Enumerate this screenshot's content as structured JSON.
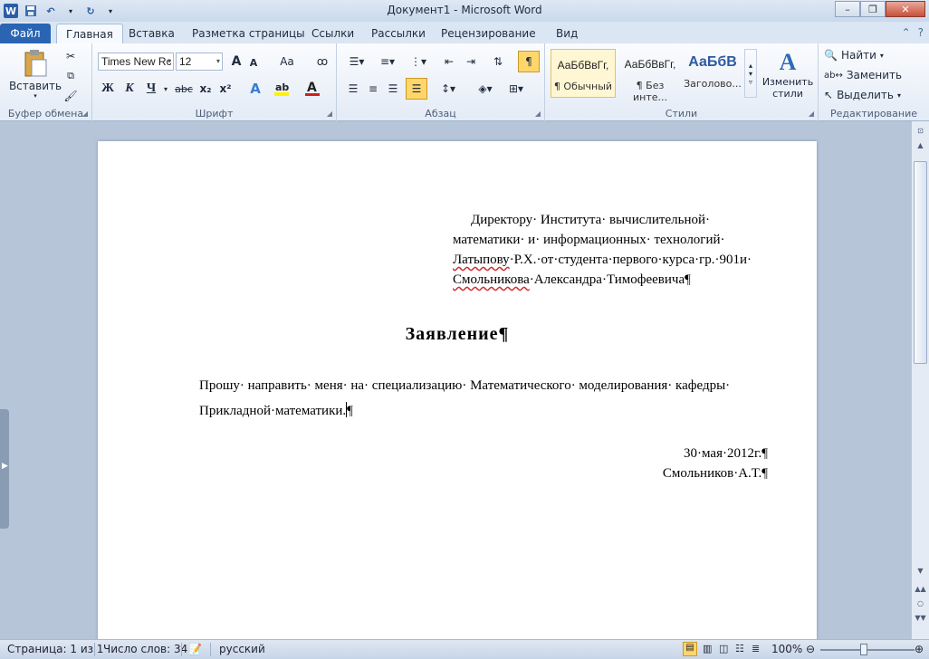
{
  "window": {
    "title": "Документ1 - Microsoft Word"
  },
  "tabs": {
    "file": "Файл",
    "home": "Главная",
    "insert": "Вставка",
    "layout": "Разметка страницы",
    "references": "Ссылки",
    "mailings": "Рассылки",
    "review": "Рецензирование",
    "view": "Вид"
  },
  "ribbon": {
    "clipboard": {
      "label": "Буфер обмена",
      "paste": "Вставить"
    },
    "font": {
      "label": "Шрифт",
      "name": "Times New Rc",
      "size": "12",
      "grow": "A",
      "shrink": "A",
      "case": "Aa",
      "bold": "Ж",
      "italic": "К",
      "underline": "Ч",
      "strike": "abc",
      "sub": "x₂",
      "sup": "x²"
    },
    "paragraph": {
      "label": "Абзац"
    },
    "styles": {
      "label": "Стили",
      "sample1": "АаБбВвГг,",
      "name1": "¶ Обычный",
      "sample2": "АаБбВвГг,",
      "name2": "¶ Без инте...",
      "sample3": "АаБбВ",
      "name3": "Заголово...",
      "change": "Изменить стили"
    },
    "editing": {
      "label": "Редактирование",
      "find": "Найти",
      "replace": "Заменить",
      "select": "Выделить"
    }
  },
  "document": {
    "addr_line1": "Директору· Института· вычислительной·",
    "addr_line2": "математики· и· информационных· технологий·",
    "addr_line3a": "Латыпову",
    "addr_line3b": "·Р.Х.·от·студента·первого·курса·гр.·901и·",
    "addr_line4a": "Смольникова",
    "addr_line4b": "·Александра·Тимофеевича¶",
    "title": "Заявление¶",
    "body_line1": "Прошу· направить· меня· на· специализацию· Математического· моделирования· кафедры·",
    "body_line2": "Прикладной·математики.",
    "body_mark": "¶",
    "date": "30·мая·2012г.¶",
    "signature": "Смольников·А.Т.¶"
  },
  "status": {
    "page": "Страница: 1 из 1",
    "words": "Число слов: 34",
    "lang": "русский",
    "zoom": "100%"
  }
}
